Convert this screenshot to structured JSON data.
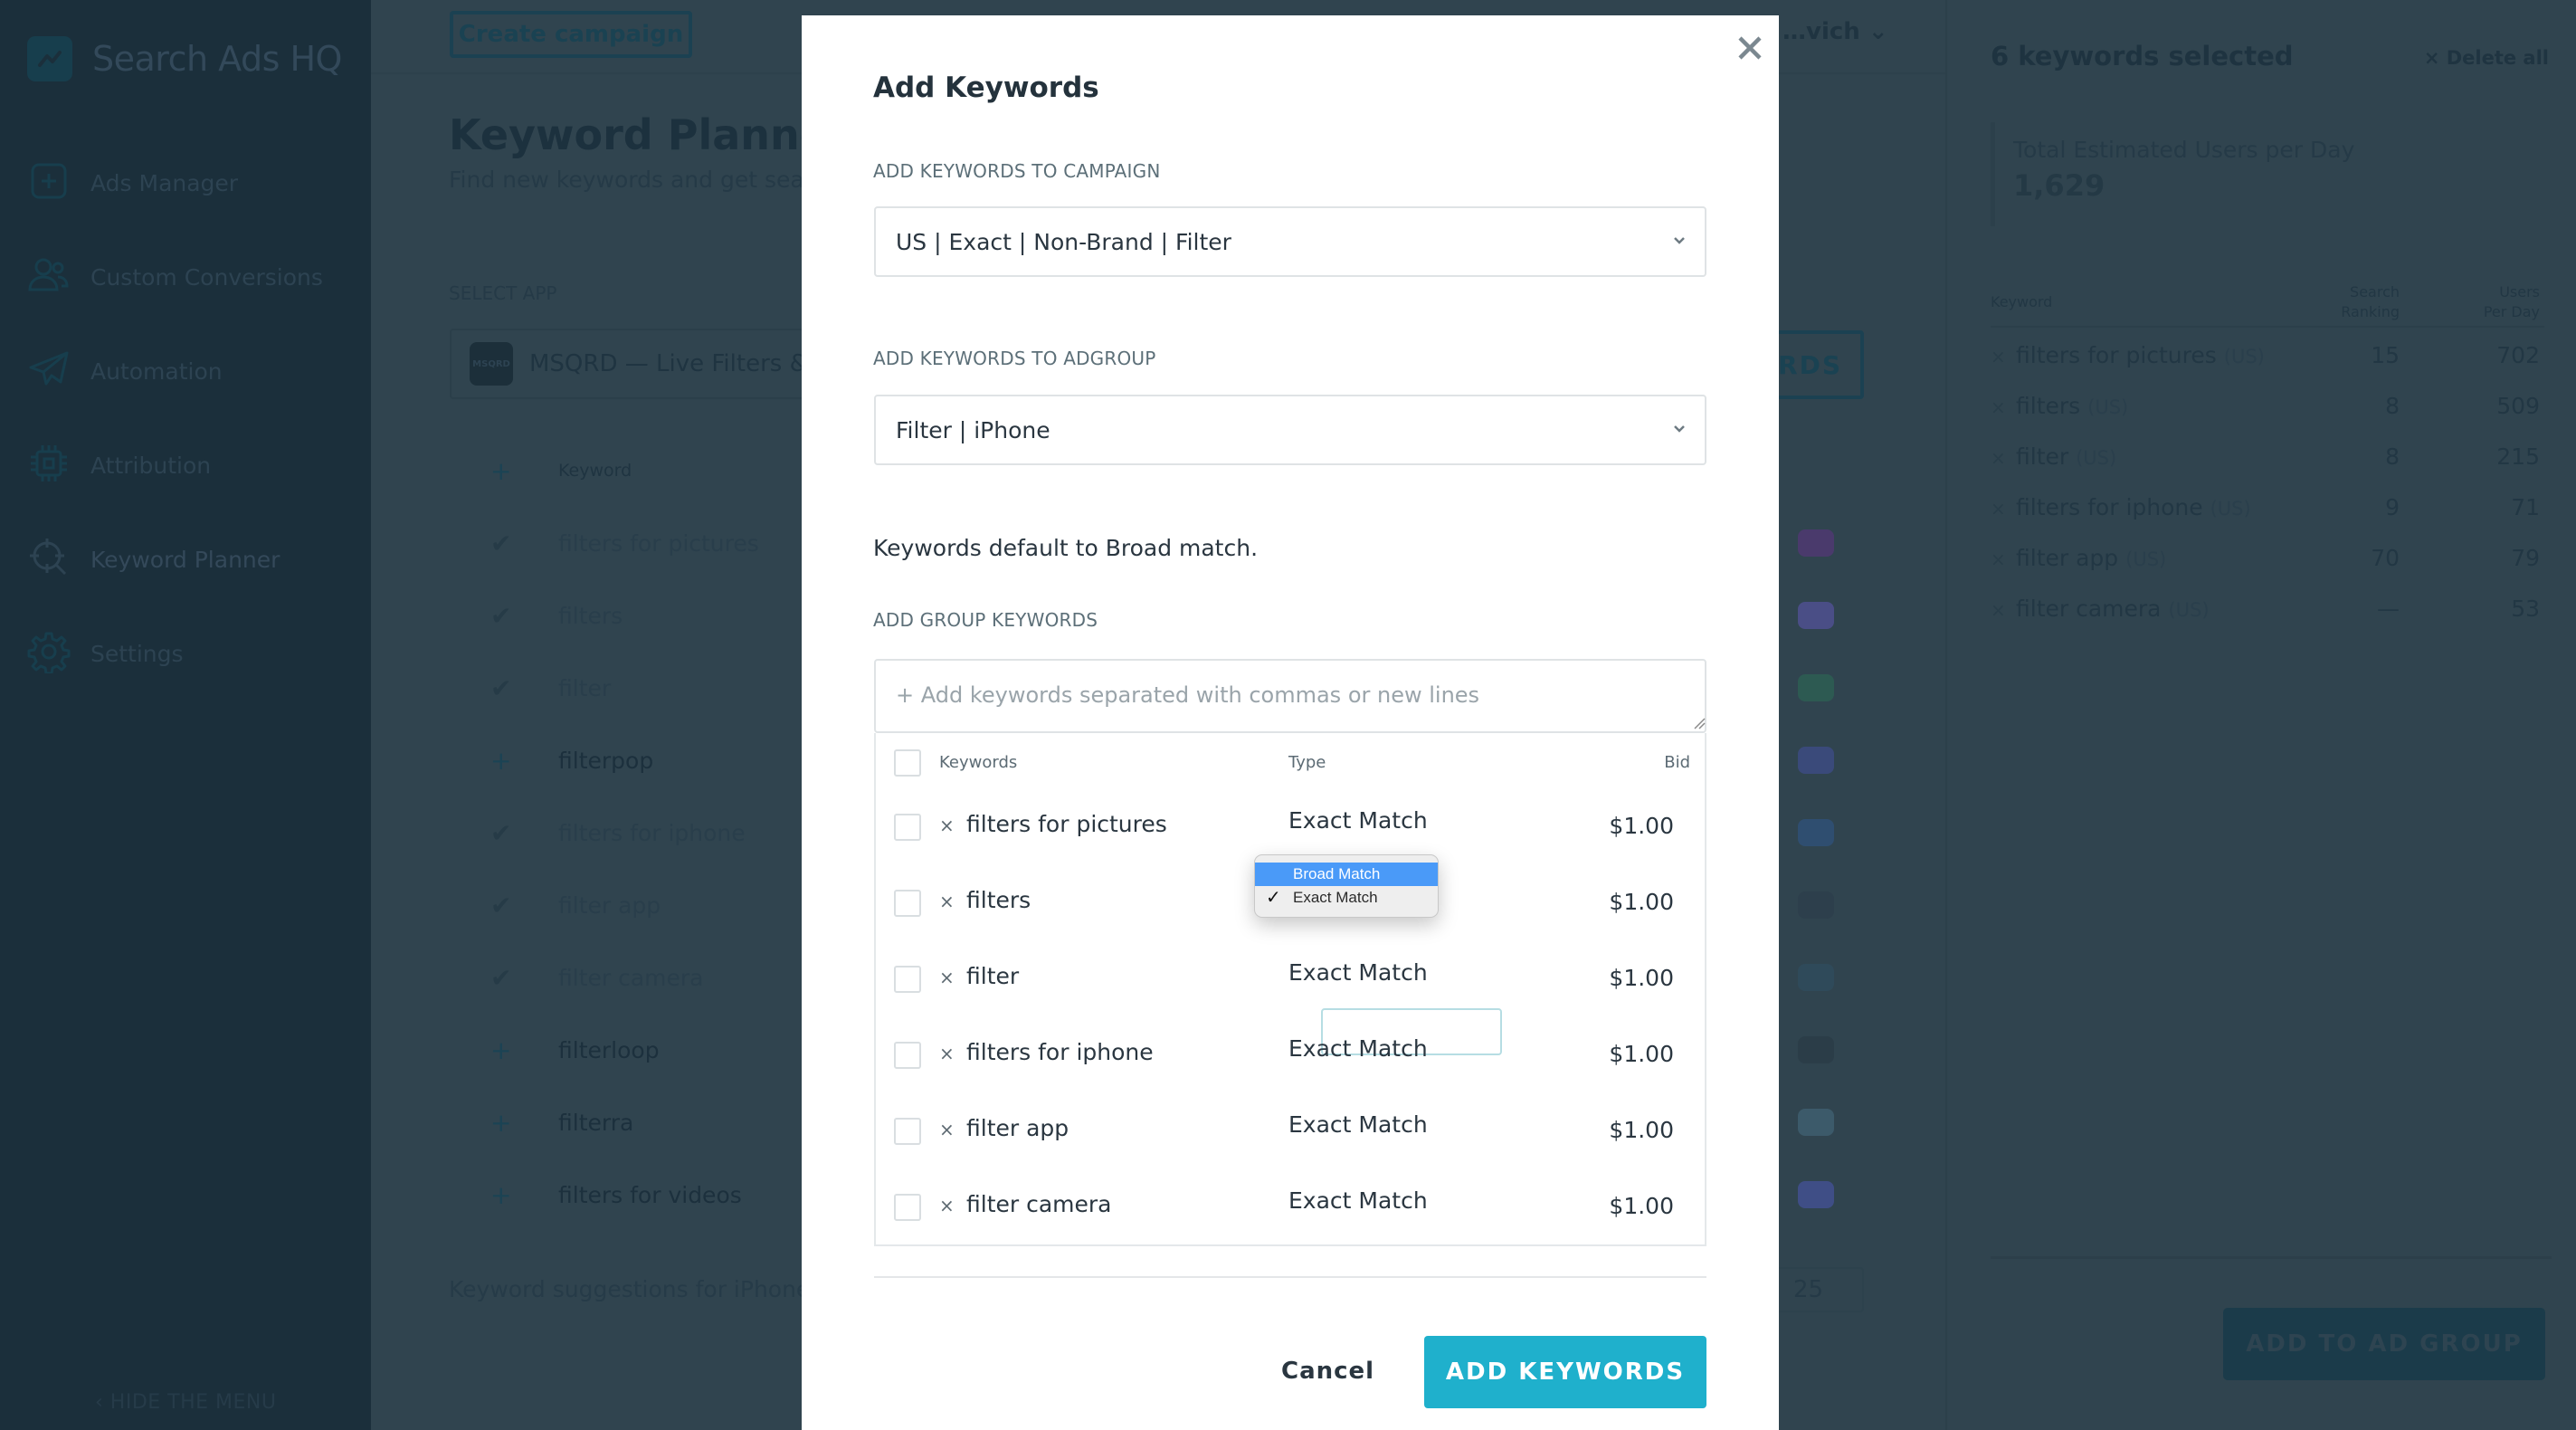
{
  "app": {
    "name": "Search Ads HQ"
  },
  "sidebar": {
    "items": [
      {
        "label": "Ads Manager",
        "icon": "plus-square-icon"
      },
      {
        "label": "Custom Conversions",
        "icon": "users-icon"
      },
      {
        "label": "Automation",
        "icon": "paper-plane-icon"
      },
      {
        "label": "Attribution",
        "icon": "chip-icon"
      },
      {
        "label": "Keyword Planner",
        "icon": "target-search-icon",
        "active": true
      },
      {
        "label": "Settings",
        "icon": "gear-icon"
      }
    ],
    "hide_menu": "‹ HIDE THE MENU"
  },
  "topbar": {
    "create_campaign": "Create campaign",
    "user_name": "…vich ⌄"
  },
  "page": {
    "title": "Keyword Planner",
    "subtitle": "Find new keywords and get searc",
    "select_app_label": "SELECT APP",
    "app_name": "MSQRD — Live Filters & Fa",
    "app_icon_text": "MSQRD",
    "get_keywords_button": "RDS",
    "table_header": "Keyword",
    "keywords": [
      {
        "keyword": "filters for pictures",
        "state": "added"
      },
      {
        "keyword": "filters",
        "state": "added"
      },
      {
        "keyword": "filter",
        "state": "added"
      },
      {
        "keyword": "filterpop",
        "state": "new"
      },
      {
        "keyword": "filters for iphone",
        "state": "added"
      },
      {
        "keyword": "filter app",
        "state": "added"
      },
      {
        "keyword": "filter camera",
        "state": "added"
      },
      {
        "keyword": "filterloop",
        "state": "new"
      },
      {
        "keyword": "filterra",
        "state": "new"
      },
      {
        "keyword": "filters for videos",
        "state": "new"
      }
    ],
    "footer_text": "Keyword suggestions for iPhone p",
    "per_page": "25"
  },
  "right_panel": {
    "title": "6 keywords selected",
    "delete_all": "× Delete all",
    "total_label": "Total Estimated Users per Day",
    "total_value": "1,629",
    "columns": {
      "keyword": "Keyword",
      "ranking_l1": "Search",
      "ranking_l2": "Ranking",
      "users_l1": "Users",
      "users_l2": "Per Day"
    },
    "rows": [
      {
        "keyword": "filters for pictures",
        "country": "(US)",
        "ranking": "15",
        "users": "702"
      },
      {
        "keyword": "filters",
        "country": "(US)",
        "ranking": "8",
        "users": "509"
      },
      {
        "keyword": "filter",
        "country": "(US)",
        "ranking": "8",
        "users": "215"
      },
      {
        "keyword": "filters for iphone",
        "country": "(US)",
        "ranking": "9",
        "users": "71"
      },
      {
        "keyword": "filter app",
        "country": "(US)",
        "ranking": "70",
        "users": "79"
      },
      {
        "keyword": "filter camera",
        "country": "(US)",
        "ranking": "—",
        "users": "53"
      }
    ],
    "add_button": "ADD TO AD GROUP"
  },
  "modal": {
    "title": "Add Keywords",
    "campaign_label": "ADD KEYWORDS TO CAMPAIGN",
    "campaign_value": "US | Exact | Non-Brand | Filter",
    "adgroup_label": "ADD KEYWORDS TO ADGROUP",
    "adgroup_value": "Filter | iPhone",
    "help_text": "Keywords default to Broad match.",
    "group_keywords_label": "ADD GROUP KEYWORDS",
    "input_placeholder": "+ Add keywords separated with commas or new lines",
    "input_value": "",
    "table_columns": {
      "keywords": "Keywords",
      "type": "Type",
      "bid": "Bid"
    },
    "rows": [
      {
        "keyword": "filters for pictures",
        "type": "Exact Match",
        "bid": "$1.00"
      },
      {
        "keyword": "filters",
        "type": "Exact Match",
        "bid": "$1.00"
      },
      {
        "keyword": "filter",
        "type": "Exact Match",
        "bid": "$1.00"
      },
      {
        "keyword": "filters for iphone",
        "type": "Exact Match",
        "bid": "$1.00"
      },
      {
        "keyword": "filter app",
        "type": "Exact Match",
        "bid": "$1.00"
      },
      {
        "keyword": "filter camera",
        "type": "Exact Match",
        "bid": "$1.00"
      }
    ],
    "type_dropdown": {
      "options": [
        "Broad Match",
        "Exact Match"
      ],
      "highlighted": "Broad Match",
      "selected": "Exact Match",
      "check_glyph": "✓"
    },
    "remove_glyph": "×",
    "cancel": "Cancel",
    "submit": "ADD KEYWORDS"
  },
  "colors": {
    "accent": "#1fb0cc",
    "sidebar_bg": "#1b2f3b",
    "overlay_bg": "#30444f",
    "menu_highlight": "#4a9af8"
  }
}
